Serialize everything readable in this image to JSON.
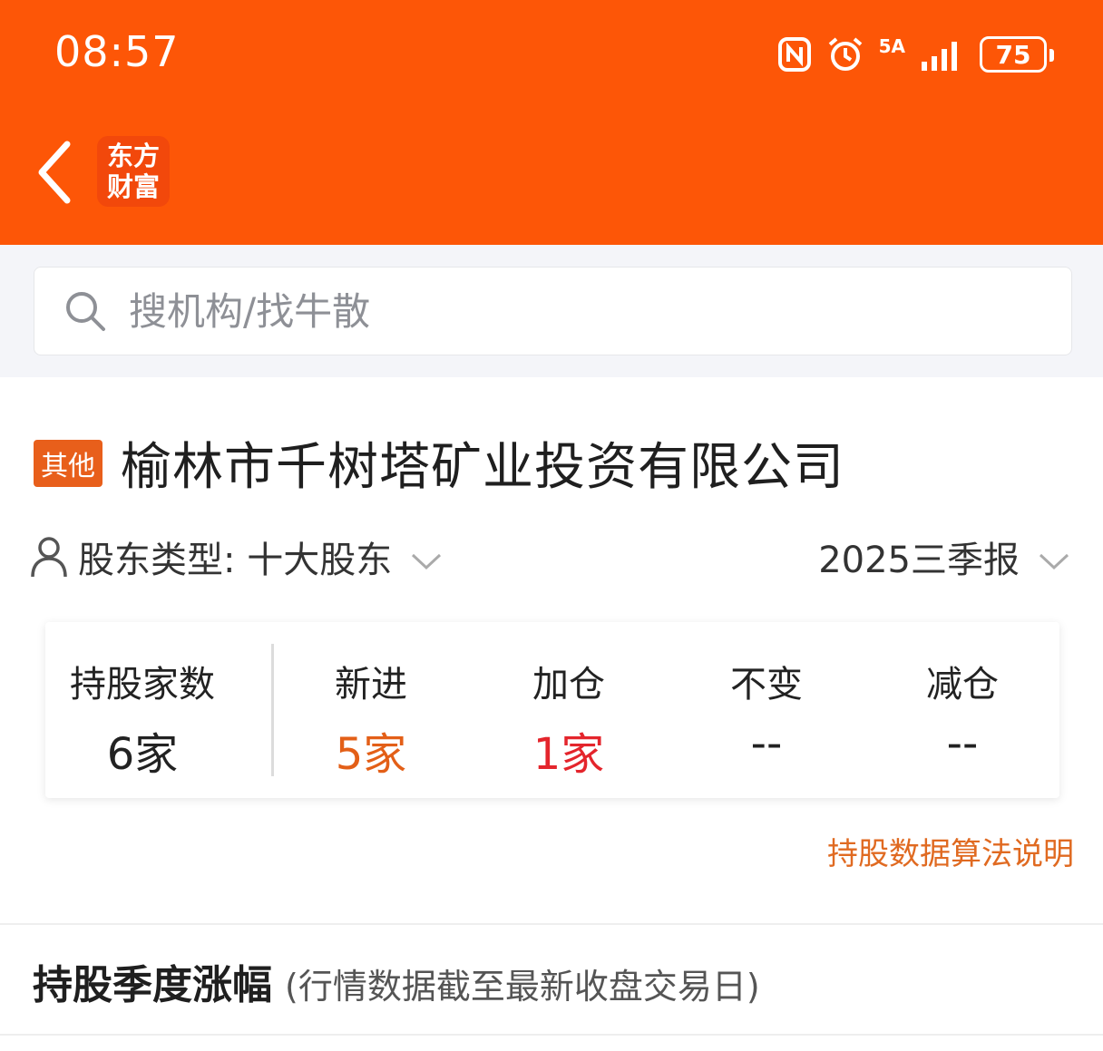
{
  "status_bar": {
    "time": "08:57",
    "network_label": "5A",
    "battery": "75",
    "icons": [
      "nfc-icon",
      "alarm-icon",
      "signal-icon",
      "battery-icon"
    ]
  },
  "header": {
    "logo_line1": "东方",
    "logo_line2": "财富",
    "bg_color": "#fd5607"
  },
  "search": {
    "placeholder": "搜机构/找牛散"
  },
  "company": {
    "tag": "其他",
    "name": "榆林市千树塔矿业投资有限公司"
  },
  "filters": {
    "holder_type_label": "股东类型: 十大股东",
    "period": "2025三季报"
  },
  "stats": {
    "holdings": {
      "label": "持股家数",
      "value": "6家",
      "color": "#222222"
    },
    "items": [
      {
        "label": "新进",
        "value": "5家",
        "color": "#e35f17"
      },
      {
        "label": "加仓",
        "value": "1家",
        "color": "#e4252c"
      },
      {
        "label": "不变",
        "value": "--",
        "color": "#222222"
      },
      {
        "label": "减仓",
        "value": "--",
        "color": "#222222"
      }
    ]
  },
  "explain_link": "持股数据算法说明",
  "section": {
    "title": "持股季度涨幅",
    "note": "(行情数据截至最新收盘交易日)"
  }
}
